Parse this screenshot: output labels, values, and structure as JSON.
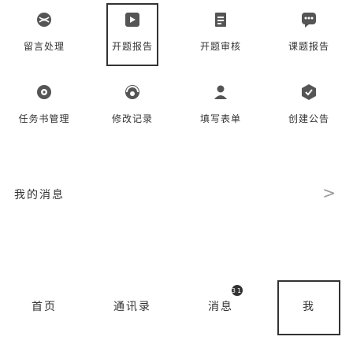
{
  "grid": [
    {
      "label": "留言处理",
      "icon": "sports-ball-icon",
      "color": "#5b5b5b"
    },
    {
      "label": "开题报告",
      "icon": "play-screen-icon",
      "color": "#5b5b5b"
    },
    {
      "label": "开题审核",
      "icon": "document-icon",
      "color": "#5b5b5b"
    },
    {
      "label": "课题报告",
      "icon": "chat-icon",
      "color": "#5b5b5b"
    },
    {
      "label": "任务书管理",
      "icon": "disc-icon",
      "color": "#5b5b5b"
    },
    {
      "label": "修改记录",
      "icon": "donut-icon",
      "color": "#5b5b5b"
    },
    {
      "label": "填写表单",
      "icon": "user-icon",
      "color": "#5b5b5b"
    },
    {
      "label": "创建公告",
      "icon": "badge-icon",
      "color": "#5b5b5b"
    }
  ],
  "section": {
    "title": "我的消息",
    "chevron": ">"
  },
  "bottom_nav": [
    {
      "label": "首页"
    },
    {
      "label": "通讯录"
    },
    {
      "label": "消息",
      "badge": "31"
    },
    {
      "label": "我"
    }
  ]
}
